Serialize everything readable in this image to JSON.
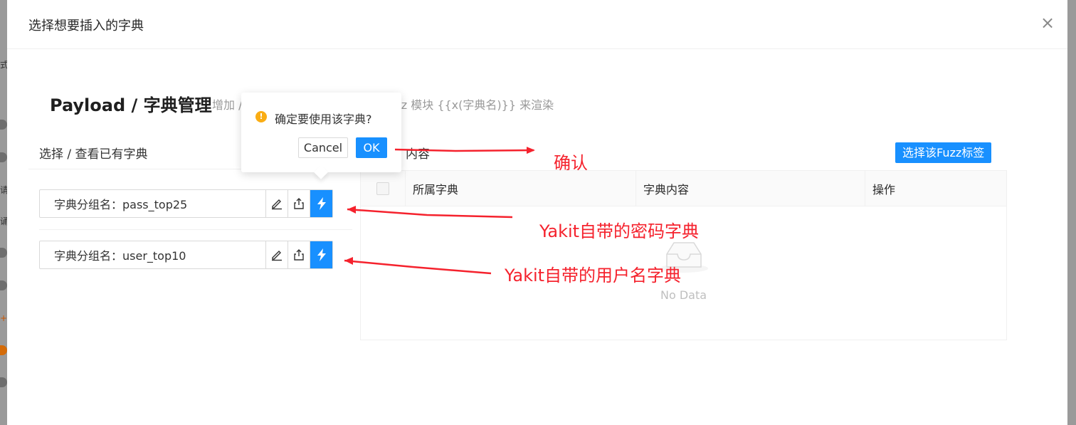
{
  "modal": {
    "title": "选择想要插入的字典",
    "close_glyph": "×"
  },
  "page": {
    "heading": "Payload / 字典管理",
    "subtitle": "增加 / ",
    "subtitle_tail": "fuzz 模块 {{x(字典名)}} 来渲染"
  },
  "left_panel": {
    "title": "选择 / 查看已有字典",
    "groups": [
      {
        "label": "字典分组名：pass_top25"
      },
      {
        "label": "字典分组名：user_top10"
      }
    ]
  },
  "right_panel": {
    "title": "内容",
    "fuzz_button": "选择该Fuzz标签",
    "columns": [
      "所属字典",
      "字典内容",
      "操作"
    ],
    "empty_text": "No Data"
  },
  "popconfirm": {
    "message": "确定要使用该字典?",
    "cancel_label": "Cancel",
    "ok_label": "OK"
  },
  "annotations": {
    "confirm": "确认",
    "password_dict": "Yakit自带的密码字典",
    "username_dict": "Yakit自带的用户名字典"
  },
  "colors": {
    "primary": "#1890ff",
    "annotation": "#f5222d",
    "warning": "#faad14"
  }
}
